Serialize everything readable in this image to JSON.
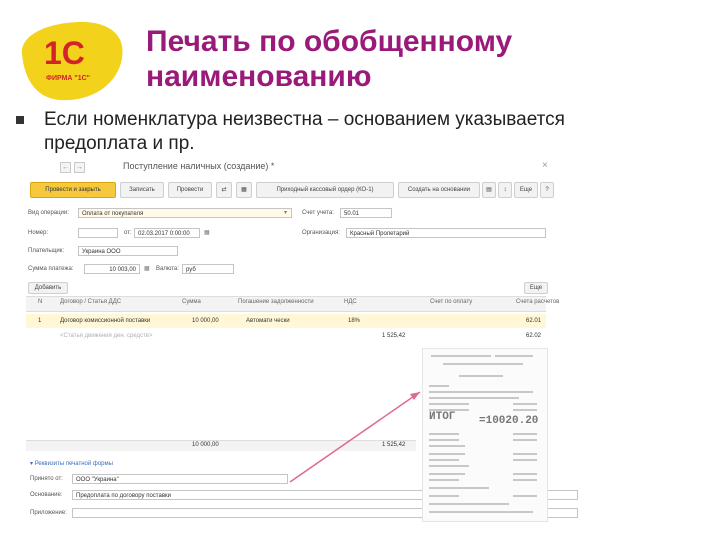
{
  "slide": {
    "logo_text": "1С",
    "logo_sub": "ФИРМА \"1С\"",
    "title_line1": "Печать по обобщенному",
    "title_line2": "наименованию",
    "bullet_line1": "Если номенклатура неизвестна – основанием указывается",
    "bullet_line2": "предоплата и пр."
  },
  "window": {
    "nav_back": "←",
    "nav_fwd": "→",
    "title": "Поступление наличных (создание) *",
    "close": "×",
    "toolbar": {
      "post_close": "Провести и закрыть",
      "save": "Записать",
      "post": "Провести",
      "print_pko": "Приходный кассовый ордер (КО-1)",
      "create_based": "Создать на основании",
      "more": "Еще",
      "help": "?"
    },
    "form": {
      "op_type_label": "Вид операции:",
      "op_type_value": "Оплата от покупателя",
      "account_label": "Счет учета:",
      "account_value": "50.01",
      "number_label": "Номер:",
      "date_label": "от:",
      "date_value": "02.03.2017 0:00:00",
      "org_label": "Организация:",
      "org_value": "Красный Пролетарий",
      "payer_label": "Плательщик:",
      "payer_value": "Украина ООО",
      "amount_label": "Сумма платежа:",
      "amount_value": "10 003,00",
      "currency_label": "Валюта:",
      "currency_value": "руб"
    },
    "table": {
      "add_button": "Добавить",
      "more_button": "Еще",
      "headers": [
        "N",
        "Договор / Статья ДДС",
        "Сумма",
        "Погашение задолженности",
        "НДС",
        "Счет по оплату",
        "Счета расчетов"
      ],
      "row": {
        "n": "1",
        "contract": "Договор комиссионной поставки",
        "sum": "10 000,00",
        "repay": "Автомати чески",
        "vat": "18%",
        "acct": "62.01"
      },
      "row_vat_amount": "1 525,42",
      "row_acct2": "62.02",
      "empty_row": "<Статья движения ден. средств>",
      "total_sum": "10 000,00",
      "total_vat": "1 525,42"
    },
    "print_section": {
      "toggle": "Реквизиты печатной формы",
      "accepted_label": "Принято от:",
      "accepted_value": "ООО \"Украина\"",
      "basis_label": "Основание:",
      "basis_value": "Предоплата по договору поставки",
      "appendix_label": "Приложение:"
    },
    "receipt": {
      "big_text": "ИТОГ",
      "total": "=10020.20"
    }
  },
  "colors": {
    "title": "#9a1a7a",
    "primary_button": "#f6c93c",
    "logo_yellow": "#f3d21c",
    "logo_red": "#d2232a",
    "arrow": "#e06a8a"
  }
}
